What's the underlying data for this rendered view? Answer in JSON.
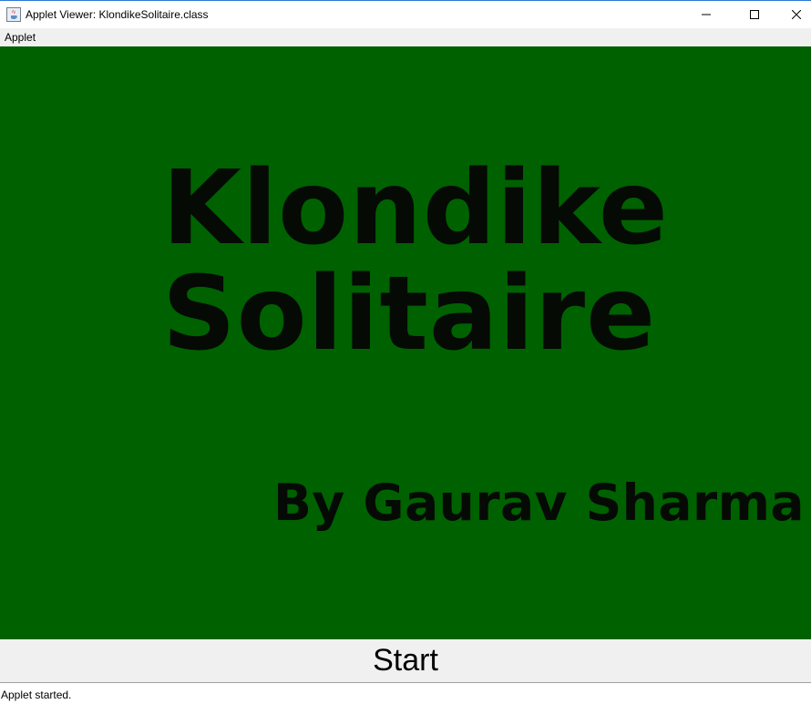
{
  "window": {
    "title": "Applet Viewer: KlondikeSolitaire.class",
    "icon": "java-icon",
    "controls": [
      "minimize-icon",
      "maximize-icon",
      "close-icon"
    ]
  },
  "menubar": {
    "items": [
      {
        "label": "Applet"
      }
    ]
  },
  "applet": {
    "background": "#006100",
    "title_line1": "Klondike",
    "title_line2": "Solitaire",
    "author": "By Gaurav Sharma",
    "start_label": "Start"
  },
  "status": {
    "text": "Applet started."
  }
}
